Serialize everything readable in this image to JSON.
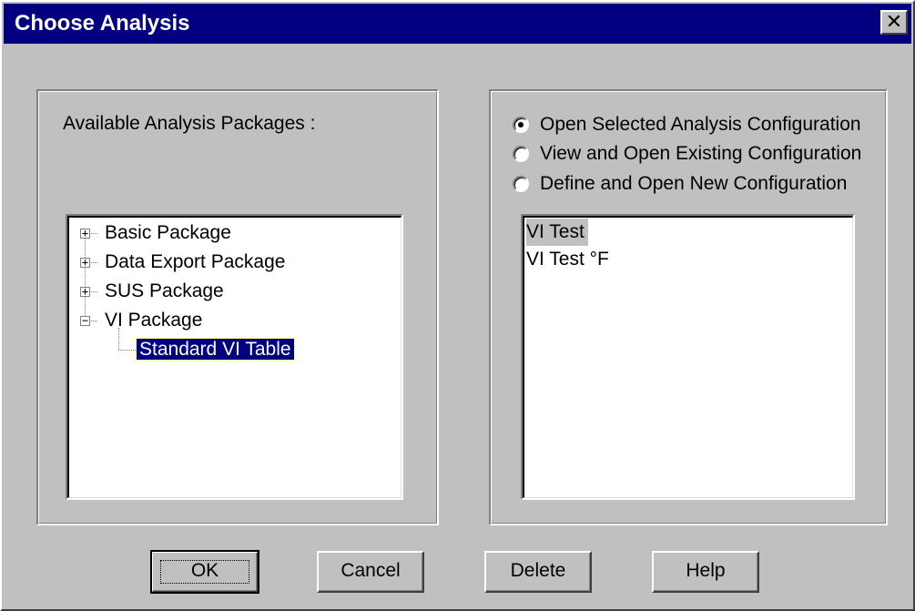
{
  "window": {
    "title": "Choose Analysis",
    "close_glyph": "✕"
  },
  "packages_panel": {
    "label": "Available Analysis Packages :",
    "tree": [
      {
        "label": "Basic Package",
        "expander": "+",
        "expanded": false
      },
      {
        "label": "Data Export Package",
        "expander": "+",
        "expanded": false
      },
      {
        "label": "SUS Package",
        "expander": "+",
        "expanded": false
      },
      {
        "label": "VI Package",
        "expander": "−",
        "expanded": true,
        "children": [
          {
            "label": "Standard VI Table",
            "selected": true
          }
        ]
      }
    ]
  },
  "config_panel": {
    "options": [
      {
        "label": "Open Selected Analysis Configuration",
        "checked": true,
        "mnemonic": "O"
      },
      {
        "label": "View and Open Existing Configuration",
        "checked": false,
        "mnemonic": "V"
      },
      {
        "label": "Define and Open New Configuration",
        "checked": false,
        "mnemonic": "N"
      }
    ],
    "configurations": [
      {
        "label": "VI Test",
        "selected": true
      },
      {
        "label": "VI Test °F",
        "selected": false
      }
    ]
  },
  "buttons": {
    "ok": "OK",
    "cancel": "Cancel",
    "delete": "Delete",
    "help": "Help"
  },
  "colors": {
    "titlebar": "#000080",
    "face": "#c0c0c0",
    "selection": "#000080"
  }
}
